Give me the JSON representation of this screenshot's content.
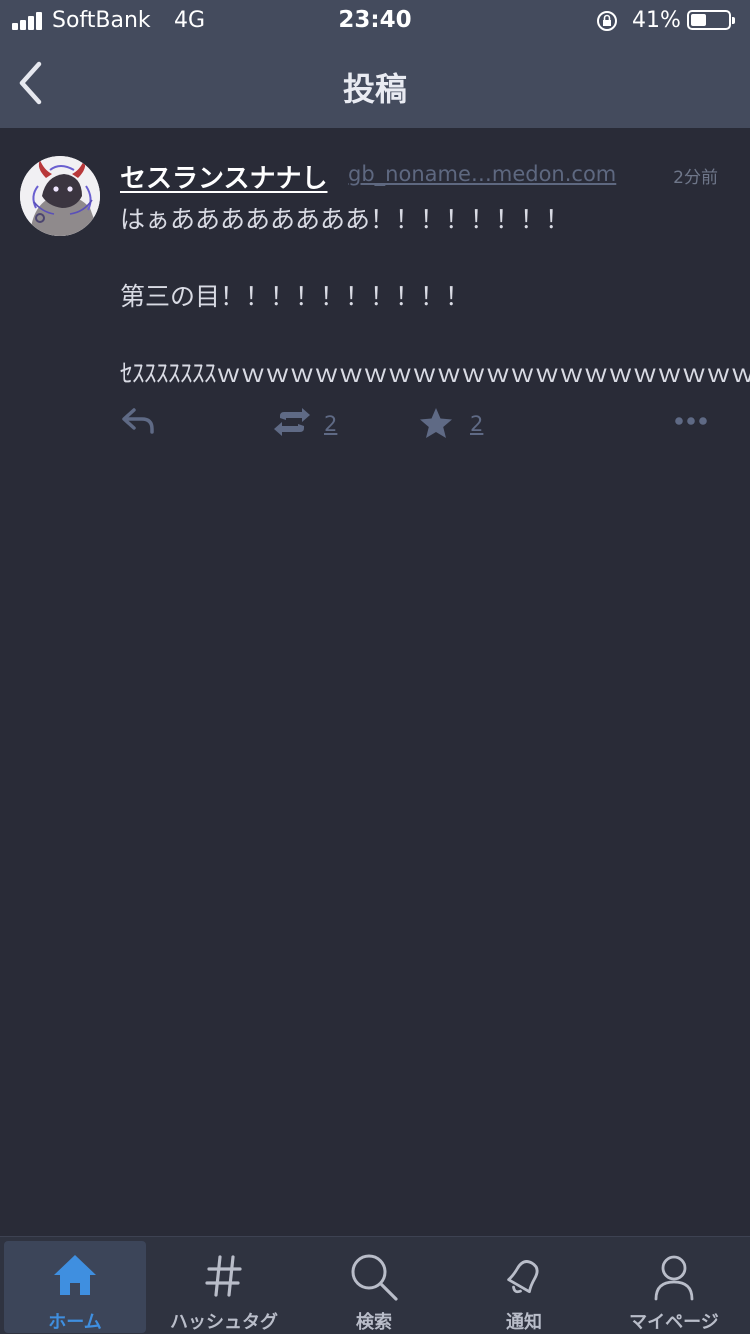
{
  "status_bar": {
    "carrier": "SoftBank",
    "network": "4G",
    "time": "23:40",
    "battery": "41%",
    "battery_level": 0.41
  },
  "header": {
    "title": "投稿",
    "back_icon": "chevron-left-icon"
  },
  "post": {
    "display_name": "セスランスナナし",
    "handle": "gb_noname…medon.com",
    "timestamp": "2分前",
    "content": [
      "はぁああああああああ！！！！！！！！",
      "第三の目！！！！！！！！！！",
      "ｾｽｽｽｽｽｽｽｗｗｗｗｗｗｗｗｗｗｗｗｗｗｗｗｗｗｗｗｗｗｗ"
    ],
    "actions": {
      "reply_icon": "reply-icon",
      "boost_icon": "boost-icon",
      "boost_count": "2",
      "favourite_icon": "star-icon",
      "favourite_count": "2",
      "more_icon": "more-icon"
    }
  },
  "tabbar": {
    "active_color": "#3f8fe0",
    "items": [
      {
        "label": "ホーム",
        "icon": "home-icon",
        "active": true
      },
      {
        "label": "ハッシュタグ",
        "icon": "hashtag-icon",
        "active": false
      },
      {
        "label": "検索",
        "icon": "search-icon",
        "active": false
      },
      {
        "label": "通知",
        "icon": "bell-icon",
        "active": false
      },
      {
        "label": "マイページ",
        "icon": "person-icon",
        "active": false
      }
    ]
  }
}
